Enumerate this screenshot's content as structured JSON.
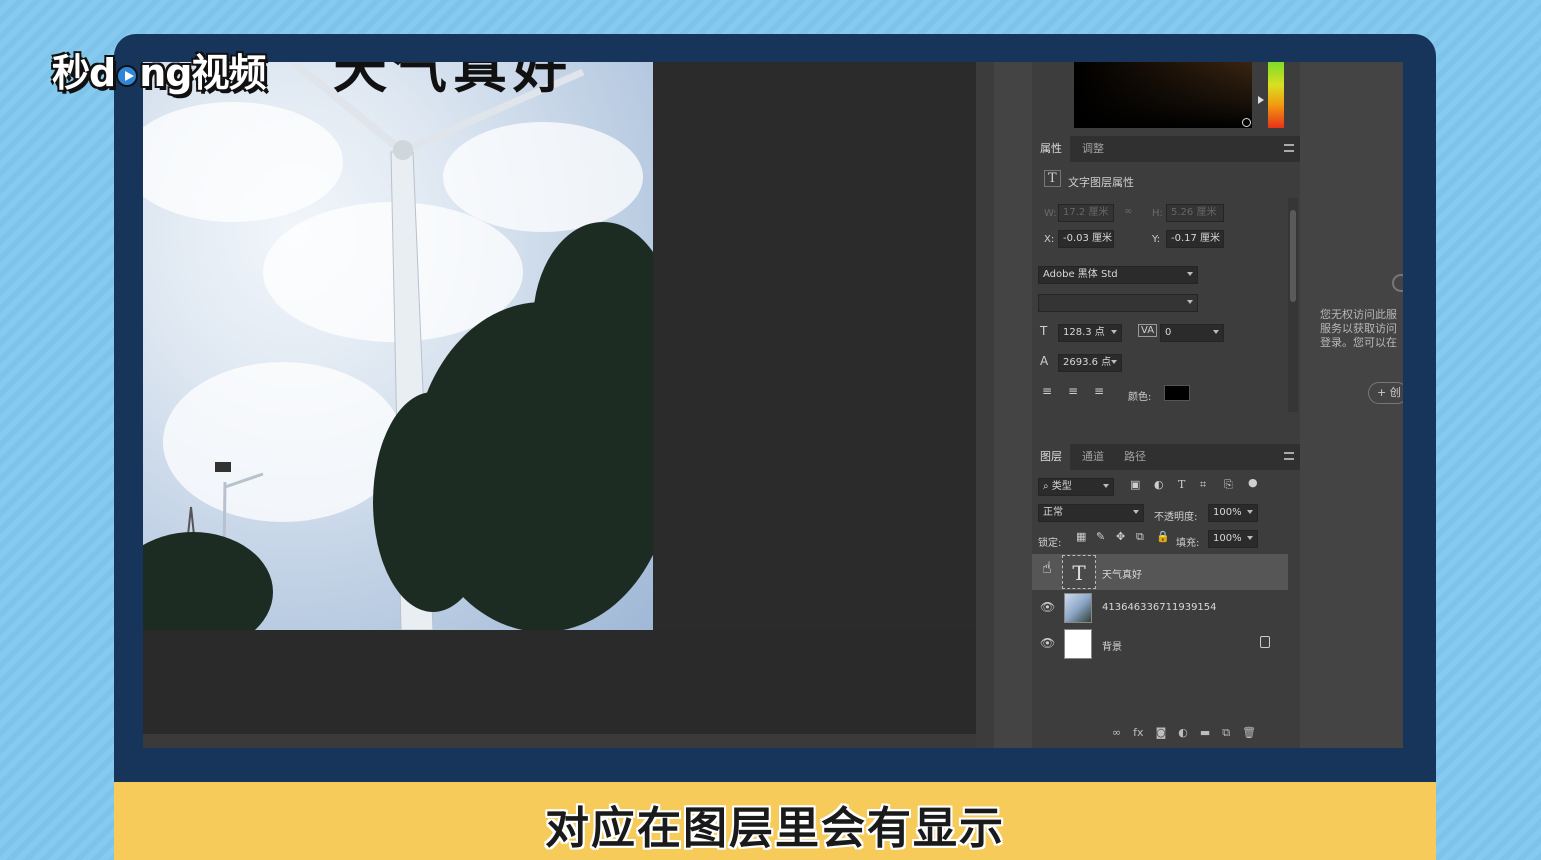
{
  "brand": {
    "logo_text_a": "秒",
    "logo_text_b": "d",
    "logo_text_c": "ng视频"
  },
  "canvas": {
    "text_layer_preview": "天气真好"
  },
  "properties_panel": {
    "tabs": [
      "属性",
      "调整"
    ],
    "section_title": "文字图层属性",
    "w_label": "W:",
    "w_value": "17.2 厘米",
    "h_label": "H:",
    "h_value": "5.26 厘米",
    "x_label": "X:",
    "x_value": "-0.03 厘米",
    "y_label": "Y:",
    "y_value": "-0.17 厘米",
    "font_family": "Adobe 黑体 Std",
    "font_style": "",
    "font_size": "128.3 点",
    "tracking": "0",
    "leading": "2693.6 点",
    "color_label": "颜色:",
    "color_value": "#000000"
  },
  "layers_panel": {
    "tabs": [
      "图层",
      "通道",
      "路径"
    ],
    "filter_kind": "类型",
    "blend_mode": "正常",
    "opacity_label": "不透明度:",
    "opacity_value": "100%",
    "lock_label": "锁定:",
    "fill_label": "填充:",
    "fill_value": "100%",
    "layers": [
      {
        "name": "天气真好",
        "type": "text",
        "selected": true
      },
      {
        "name": "41364633671193915​4",
        "type": "image",
        "selected": false
      },
      {
        "name": "背景",
        "type": "background",
        "locked": true,
        "selected": false
      }
    ],
    "footer_icons": [
      "link-icon",
      "fx-icon",
      "mask-icon",
      "adjustment-icon",
      "folder-icon",
      "new-layer-icon",
      "trash-icon"
    ]
  },
  "side_message": {
    "text": "您无权访问此服\n服务以获取访问\n登录。您可以在",
    "button": "+ 创"
  },
  "subtitle": "对应在图层里会有显示"
}
